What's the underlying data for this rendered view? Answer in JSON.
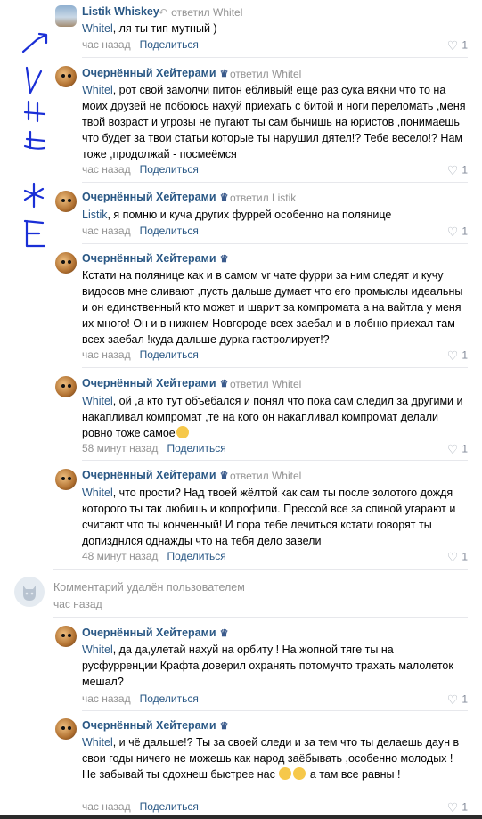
{
  "share_label": "Поделиться",
  "replied_label": "ответил",
  "comments": [
    {
      "author": "Listik Whiskey",
      "reply_to": "Whitel",
      "mention": "Whitel",
      "text": ", ля ты тип мутный )",
      "time": "час назад",
      "likes": "1"
    },
    {
      "author": "Очернённый Хейтерами",
      "reply_to": "Whitel",
      "mention": "Whitel",
      "text": ", рот свой замолчи питон ебливый! ещё раз сука вякни что то на моих друзей не побоюсь нахуй приехать с битой и ноги переломать ,меня твой возраст и угрозы не пугают ты сам бычишь на юристов ,понимаешь что будет за твои статьи которые ты нарушил дятел!? Тебе весело!? Нам тоже ,продолжай - посмеёмся",
      "time": "час назад",
      "likes": "1"
    },
    {
      "author": "Очернённый Хейтерами",
      "reply_to": "Listik",
      "mention": "Listik",
      "text": ", я помню и куча других фуррей особенно на полянице",
      "time": "час назад",
      "likes": "1"
    },
    {
      "author": "Очернённый Хейтерами",
      "reply_to": "",
      "mention": "",
      "text": "Кстати на полянице как и в самом vr чате фурри за ним следят и кучу видосов мне сливают ,пусть дальше думает что его промыслы идеальны и он единственный кто может и шарит за компромата а на вайтла у меня их много! Он и в нижнем Новгороде всех заебал и в лобню приехал там всех заебал !куда дальше дурка гастролирует!?",
      "time": "час назад",
      "likes": "1"
    },
    {
      "author": "Очернённый Хейтерами",
      "reply_to": "Whitel",
      "mention": "Whitel",
      "text": ", ой ,а кто тут объебался и понял что пока сам следил за другими и накапливал компромат ,те на кого он накапливал компромат делали ровно тоже самое",
      "time": "58 минут назад",
      "likes": "1"
    },
    {
      "author": "Очернённый Хейтерами",
      "reply_to": "Whitel",
      "mention": "Whitel",
      "text": ", что прости? Над твоей жёлтой как сам ты после золотого дождя которого ты так любишь и копрофили. Прессой все за спиной угарают и считают что ты конченный! И пора тебе лечиться кстати говорят ты допизднлся однажды что на тебя дело завели",
      "time": "48 минут назад",
      "likes": "1"
    },
    {
      "author": "Очернённый Хейтерами",
      "reply_to": "Whitel",
      "mention": "Whitel",
      "text": ", да да,улетай нахуй на орбиту ! На жопной тяге ты на русфурренции Крафта доверил охранять потомучто трахать малолеток мешал?",
      "time": "час назад",
      "likes": "1"
    },
    {
      "author": "Очернённый Хейтерами",
      "reply_to": "Whitel",
      "mention": "Whitel",
      "text": ", и чё дальше!? Ты за своей следи и за тем что ты делаешь даун в свои годы ничего не можешь как народ заёбывать ,особенно молодых ! Не забывай ты сдохнеш быстрее нас",
      "text_tail": " а там все равны !",
      "time": "час назад",
      "likes": "1"
    }
  ],
  "deleted": {
    "text": "Комментарий удалён пользователем",
    "time": "час назад"
  }
}
